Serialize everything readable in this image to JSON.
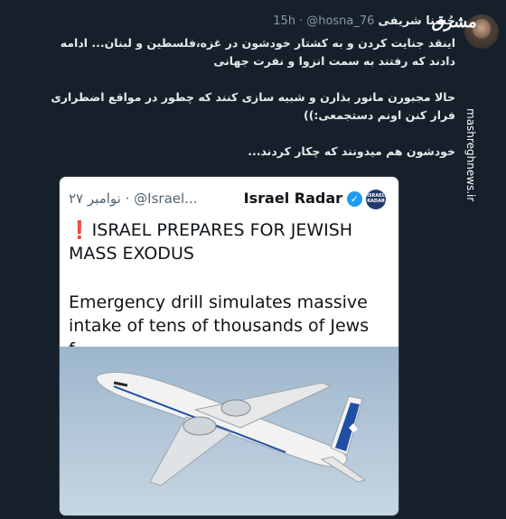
{
  "author": {
    "display_name": "حُسنا شریفی",
    "handle": "@hosna_76",
    "separator": "·",
    "time": "15h"
  },
  "tweet": {
    "paragraphs": [
      "اینقد جنایت کردن و  به کشتار خودشون در غزه،فلسطین و لبنان... ادامه دادند که رفتند به سمت انزوا و نفرت جهانی",
      "حالا مجبورن مانور بذارن و شبیه سازی کنند که چطور در مواقع اضطراری فرار کنن اونم دستجمعی:))",
      "خودشون  هم میدونند که چکار کردند..."
    ]
  },
  "watermark": {
    "logo_text": "مشرق",
    "url": "mashreghnews.ir"
  },
  "quote": {
    "badge_text": "ISRAEL RADAR",
    "account_name": "Israel Radar",
    "handle": "@Israel...",
    "time": "۲۷ نوامبر",
    "separator": "·",
    "exclamation": "❗",
    "headline": "ISRAEL PREPARES FOR JEWISH MASS EXODUS",
    "body": "Emergency drill simulates massive intake of tens of thousands of Jews f...",
    "image_alt_icon": "airplane-photo",
    "colors": {
      "verified": "#1d9bf0",
      "exclamation": "#e0245e",
      "airline_blue": "#1f4fa3"
    }
  }
}
